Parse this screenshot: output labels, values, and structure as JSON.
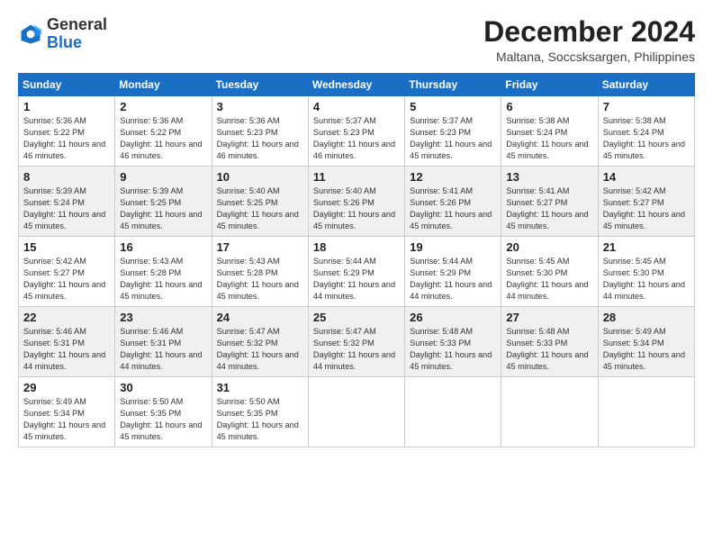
{
  "logo": {
    "general": "General",
    "blue": "Blue"
  },
  "header": {
    "month": "December 2024",
    "location": "Maltana, Soccsksargen, Philippines"
  },
  "weekdays": [
    "Sunday",
    "Monday",
    "Tuesday",
    "Wednesday",
    "Thursday",
    "Friday",
    "Saturday"
  ],
  "weeks": [
    [
      {
        "day": "1",
        "sunrise": "5:36 AM",
        "sunset": "5:22 PM",
        "daylight": "11 hours and 46 minutes."
      },
      {
        "day": "2",
        "sunrise": "5:36 AM",
        "sunset": "5:22 PM",
        "daylight": "11 hours and 46 minutes."
      },
      {
        "day": "3",
        "sunrise": "5:36 AM",
        "sunset": "5:23 PM",
        "daylight": "11 hours and 46 minutes."
      },
      {
        "day": "4",
        "sunrise": "5:37 AM",
        "sunset": "5:23 PM",
        "daylight": "11 hours and 46 minutes."
      },
      {
        "day": "5",
        "sunrise": "5:37 AM",
        "sunset": "5:23 PM",
        "daylight": "11 hours and 45 minutes."
      },
      {
        "day": "6",
        "sunrise": "5:38 AM",
        "sunset": "5:24 PM",
        "daylight": "11 hours and 45 minutes."
      },
      {
        "day": "7",
        "sunrise": "5:38 AM",
        "sunset": "5:24 PM",
        "daylight": "11 hours and 45 minutes."
      }
    ],
    [
      {
        "day": "8",
        "sunrise": "5:39 AM",
        "sunset": "5:24 PM",
        "daylight": "11 hours and 45 minutes."
      },
      {
        "day": "9",
        "sunrise": "5:39 AM",
        "sunset": "5:25 PM",
        "daylight": "11 hours and 45 minutes."
      },
      {
        "day": "10",
        "sunrise": "5:40 AM",
        "sunset": "5:25 PM",
        "daylight": "11 hours and 45 minutes."
      },
      {
        "day": "11",
        "sunrise": "5:40 AM",
        "sunset": "5:26 PM",
        "daylight": "11 hours and 45 minutes."
      },
      {
        "day": "12",
        "sunrise": "5:41 AM",
        "sunset": "5:26 PM",
        "daylight": "11 hours and 45 minutes."
      },
      {
        "day": "13",
        "sunrise": "5:41 AM",
        "sunset": "5:27 PM",
        "daylight": "11 hours and 45 minutes."
      },
      {
        "day": "14",
        "sunrise": "5:42 AM",
        "sunset": "5:27 PM",
        "daylight": "11 hours and 45 minutes."
      }
    ],
    [
      {
        "day": "15",
        "sunrise": "5:42 AM",
        "sunset": "5:27 PM",
        "daylight": "11 hours and 45 minutes."
      },
      {
        "day": "16",
        "sunrise": "5:43 AM",
        "sunset": "5:28 PM",
        "daylight": "11 hours and 45 minutes."
      },
      {
        "day": "17",
        "sunrise": "5:43 AM",
        "sunset": "5:28 PM",
        "daylight": "11 hours and 45 minutes."
      },
      {
        "day": "18",
        "sunrise": "5:44 AM",
        "sunset": "5:29 PM",
        "daylight": "11 hours and 44 minutes."
      },
      {
        "day": "19",
        "sunrise": "5:44 AM",
        "sunset": "5:29 PM",
        "daylight": "11 hours and 44 minutes."
      },
      {
        "day": "20",
        "sunrise": "5:45 AM",
        "sunset": "5:30 PM",
        "daylight": "11 hours and 44 minutes."
      },
      {
        "day": "21",
        "sunrise": "5:45 AM",
        "sunset": "5:30 PM",
        "daylight": "11 hours and 44 minutes."
      }
    ],
    [
      {
        "day": "22",
        "sunrise": "5:46 AM",
        "sunset": "5:31 PM",
        "daylight": "11 hours and 44 minutes."
      },
      {
        "day": "23",
        "sunrise": "5:46 AM",
        "sunset": "5:31 PM",
        "daylight": "11 hours and 44 minutes."
      },
      {
        "day": "24",
        "sunrise": "5:47 AM",
        "sunset": "5:32 PM",
        "daylight": "11 hours and 44 minutes."
      },
      {
        "day": "25",
        "sunrise": "5:47 AM",
        "sunset": "5:32 PM",
        "daylight": "11 hours and 44 minutes."
      },
      {
        "day": "26",
        "sunrise": "5:48 AM",
        "sunset": "5:33 PM",
        "daylight": "11 hours and 45 minutes."
      },
      {
        "day": "27",
        "sunrise": "5:48 AM",
        "sunset": "5:33 PM",
        "daylight": "11 hours and 45 minutes."
      },
      {
        "day": "28",
        "sunrise": "5:49 AM",
        "sunset": "5:34 PM",
        "daylight": "11 hours and 45 minutes."
      }
    ],
    [
      {
        "day": "29",
        "sunrise": "5:49 AM",
        "sunset": "5:34 PM",
        "daylight": "11 hours and 45 minutes."
      },
      {
        "day": "30",
        "sunrise": "5:50 AM",
        "sunset": "5:35 PM",
        "daylight": "11 hours and 45 minutes."
      },
      {
        "day": "31",
        "sunrise": "5:50 AM",
        "sunset": "5:35 PM",
        "daylight": "11 hours and 45 minutes."
      },
      null,
      null,
      null,
      null
    ]
  ]
}
